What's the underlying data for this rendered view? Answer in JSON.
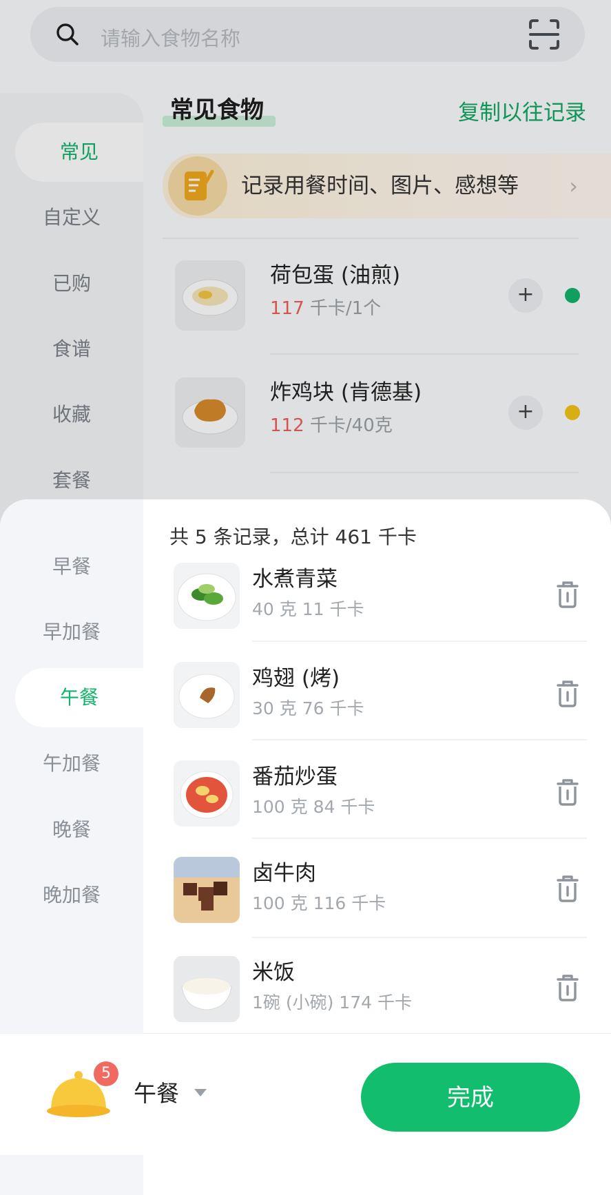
{
  "search": {
    "placeholder": "请输入食物名称",
    "icon": "search-icon",
    "scan_icon": "scan-icon"
  },
  "left_nav": {
    "items": [
      "常见",
      "自定义",
      "已购",
      "食谱",
      "收藏",
      "套餐"
    ],
    "active": "常见"
  },
  "main": {
    "section_title": "常见食物",
    "copy_link": "复制以往记录",
    "note_banner": {
      "text": "记录用餐时间、图片、感想等",
      "icon": "note-pencil-icon",
      "chevron": "›"
    },
    "foods": [
      {
        "name": "荷包蛋 (油煎)",
        "kcal": "117",
        "unit": "千卡/1个",
        "add": "+",
        "dot_color": "#12b36c"
      },
      {
        "name": "炸鸡块 (肯德基)",
        "kcal": "112",
        "unit": "千卡/40克",
        "add": "+",
        "dot_color": "#f2c518"
      }
    ]
  },
  "sheet": {
    "meals": [
      "早餐",
      "早加餐",
      "午餐",
      "午加餐",
      "晚餐",
      "晚加餐"
    ],
    "active_meal": "午餐",
    "summary": "共 5 条记录，总计 461 千卡",
    "records": [
      {
        "name": "水煮青菜",
        "meta": "40 克 11 千卡"
      },
      {
        "name": "鸡翅 (烤)",
        "meta": "30 克 76 千卡"
      },
      {
        "name": "番茄炒蛋",
        "meta": "100 克 84 千卡"
      },
      {
        "name": "卤牛肉",
        "meta": "100 克 116 千卡"
      },
      {
        "name": "米饭",
        "meta": "1碗 (小碗) 174 千卡"
      }
    ]
  },
  "bottom_bar": {
    "badge": "5",
    "meal": "午餐",
    "done_label": "完成",
    "accent": "#12bd6e"
  }
}
